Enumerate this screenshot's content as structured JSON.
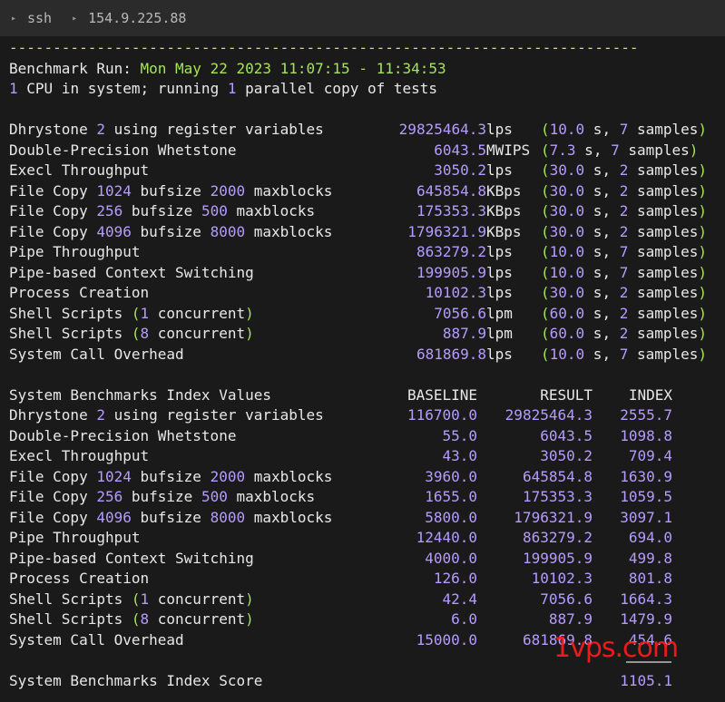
{
  "titlebar": {
    "items": [
      "ssh",
      "154.9.225.88"
    ]
  },
  "terminal": {
    "separator": "------------------------------------------------------------------------",
    "run_label": "Benchmark Run: ",
    "run_time": "Mon May 22 2023 11:07:15 - 11:34:53",
    "cpu_line": {
      "n1": "1",
      "t1": " CPU in system; running ",
      "n2": "1",
      "t2": " parallel copy of tests"
    },
    "results": [
      {
        "name": [
          [
            "w",
            "Dhrystone "
          ],
          [
            "p",
            "2"
          ],
          [
            "w",
            " using register variables"
          ]
        ],
        "value": "29825464.3",
        "unit": "lps  ",
        "time": "10.0",
        "samples": "7"
      },
      {
        "name": [
          [
            "w",
            "Double-Precision Whetstone"
          ]
        ],
        "value": "6043.5",
        "unit": "MWIPS",
        "time": "7.3",
        "samples": "7"
      },
      {
        "name": [
          [
            "w",
            "Execl Throughput"
          ]
        ],
        "value": "3050.2",
        "unit": "lps  ",
        "time": "30.0",
        "samples": "2"
      },
      {
        "name": [
          [
            "w",
            "File Copy "
          ],
          [
            "p",
            "1024"
          ],
          [
            "w",
            " bufsize "
          ],
          [
            "p",
            "2000"
          ],
          [
            "w",
            " maxblocks"
          ]
        ],
        "value": "645854.8",
        "unit": "KBps ",
        "time": "30.0",
        "samples": "2"
      },
      {
        "name": [
          [
            "w",
            "File Copy "
          ],
          [
            "p",
            "256"
          ],
          [
            "w",
            " bufsize "
          ],
          [
            "p",
            "500"
          ],
          [
            "w",
            " maxblocks"
          ]
        ],
        "value": "175353.3",
        "unit": "KBps ",
        "time": "30.0",
        "samples": "2"
      },
      {
        "name": [
          [
            "w",
            "File Copy "
          ],
          [
            "p",
            "4096"
          ],
          [
            "w",
            " bufsize "
          ],
          [
            "p",
            "8000"
          ],
          [
            "w",
            " maxblocks"
          ]
        ],
        "value": "1796321.9",
        "unit": "KBps ",
        "time": "30.0",
        "samples": "2"
      },
      {
        "name": [
          [
            "w",
            "Pipe Throughput"
          ]
        ],
        "value": "863279.2",
        "unit": "lps  ",
        "time": "10.0",
        "samples": "7"
      },
      {
        "name": [
          [
            "w",
            "Pipe-based Context Switching"
          ]
        ],
        "value": "199905.9",
        "unit": "lps  ",
        "time": "10.0",
        "samples": "7"
      },
      {
        "name": [
          [
            "w",
            "Process Creation"
          ]
        ],
        "value": "10102.3",
        "unit": "lps  ",
        "time": "30.0",
        "samples": "2"
      },
      {
        "name": [
          [
            "w",
            "Shell Scripts "
          ],
          [
            "g",
            "("
          ],
          [
            "p",
            "1"
          ],
          [
            "w",
            " concurrent"
          ],
          [
            "g",
            ")"
          ]
        ],
        "value": "7056.6",
        "unit": "lpm  ",
        "time": "60.0",
        "samples": "2"
      },
      {
        "name": [
          [
            "w",
            "Shell Scripts "
          ],
          [
            "g",
            "("
          ],
          [
            "p",
            "8"
          ],
          [
            "w",
            " concurrent"
          ],
          [
            "g",
            ")"
          ]
        ],
        "value": "887.9",
        "unit": "lpm  ",
        "time": "60.0",
        "samples": "2"
      },
      {
        "name": [
          [
            "w",
            "System Call Overhead"
          ]
        ],
        "value": "681869.8",
        "unit": "lps  ",
        "time": "10.0",
        "samples": "7"
      }
    ],
    "index_header": {
      "title": "System Benchmarks Index Values",
      "baseline": "BASELINE",
      "result": "RESULT",
      "index": "INDEX"
    },
    "index_rows": [
      {
        "name": [
          [
            "w",
            "Dhrystone "
          ],
          [
            "p",
            "2"
          ],
          [
            "w",
            " using register variables"
          ]
        ],
        "baseline": "116700.0",
        "result": "29825464.3",
        "index": "2555.7"
      },
      {
        "name": [
          [
            "w",
            "Double-Precision Whetstone"
          ]
        ],
        "baseline": "55.0",
        "result": "6043.5",
        "index": "1098.8"
      },
      {
        "name": [
          [
            "w",
            "Execl Throughput"
          ]
        ],
        "baseline": "43.0",
        "result": "3050.2",
        "index": "709.4"
      },
      {
        "name": [
          [
            "w",
            "File Copy "
          ],
          [
            "p",
            "1024"
          ],
          [
            "w",
            " bufsize "
          ],
          [
            "p",
            "2000"
          ],
          [
            "w",
            " maxblocks"
          ]
        ],
        "baseline": "3960.0",
        "result": "645854.8",
        "index": "1630.9"
      },
      {
        "name": [
          [
            "w",
            "File Copy "
          ],
          [
            "p",
            "256"
          ],
          [
            "w",
            " bufsize "
          ],
          [
            "p",
            "500"
          ],
          [
            "w",
            " maxblocks"
          ]
        ],
        "baseline": "1655.0",
        "result": "175353.3",
        "index": "1059.5"
      },
      {
        "name": [
          [
            "w",
            "File Copy "
          ],
          [
            "p",
            "4096"
          ],
          [
            "w",
            " bufsize "
          ],
          [
            "p",
            "8000"
          ],
          [
            "w",
            " maxblocks"
          ]
        ],
        "baseline": "5800.0",
        "result": "1796321.9",
        "index": "3097.1"
      },
      {
        "name": [
          [
            "w",
            "Pipe Throughput"
          ]
        ],
        "baseline": "12440.0",
        "result": "863279.2",
        "index": "694.0"
      },
      {
        "name": [
          [
            "w",
            "Pipe-based Context Switching"
          ]
        ],
        "baseline": "4000.0",
        "result": "199905.9",
        "index": "499.8"
      },
      {
        "name": [
          [
            "w",
            "Process Creation"
          ]
        ],
        "baseline": "126.0",
        "result": "10102.3",
        "index": "801.8"
      },
      {
        "name": [
          [
            "w",
            "Shell Scripts "
          ],
          [
            "g",
            "("
          ],
          [
            "p",
            "1"
          ],
          [
            "w",
            " concurrent"
          ],
          [
            "g",
            ")"
          ]
        ],
        "baseline": "42.4",
        "result": "7056.6",
        "index": "1664.3"
      },
      {
        "name": [
          [
            "w",
            "Shell Scripts "
          ],
          [
            "g",
            "("
          ],
          [
            "p",
            "8"
          ],
          [
            "w",
            " concurrent"
          ],
          [
            "g",
            ")"
          ]
        ],
        "baseline": "6.0",
        "result": "887.9",
        "index": "1479.9"
      },
      {
        "name": [
          [
            "w",
            "System Call Overhead"
          ]
        ],
        "baseline": "15000.0",
        "result": "681869.8",
        "index": "454.6"
      }
    ],
    "score_label": "System Benchmarks Index Score",
    "score_value": "1105.1"
  },
  "watermark": "1vps.com",
  "colors": {
    "background": "#1a1a1a",
    "titlebar": "#2b2b2b",
    "text": "#e8e8e8",
    "yellow": "#d4e157",
    "green": "#a5e35c",
    "purple": "#b59cff",
    "watermark": "#ff1a1a"
  }
}
